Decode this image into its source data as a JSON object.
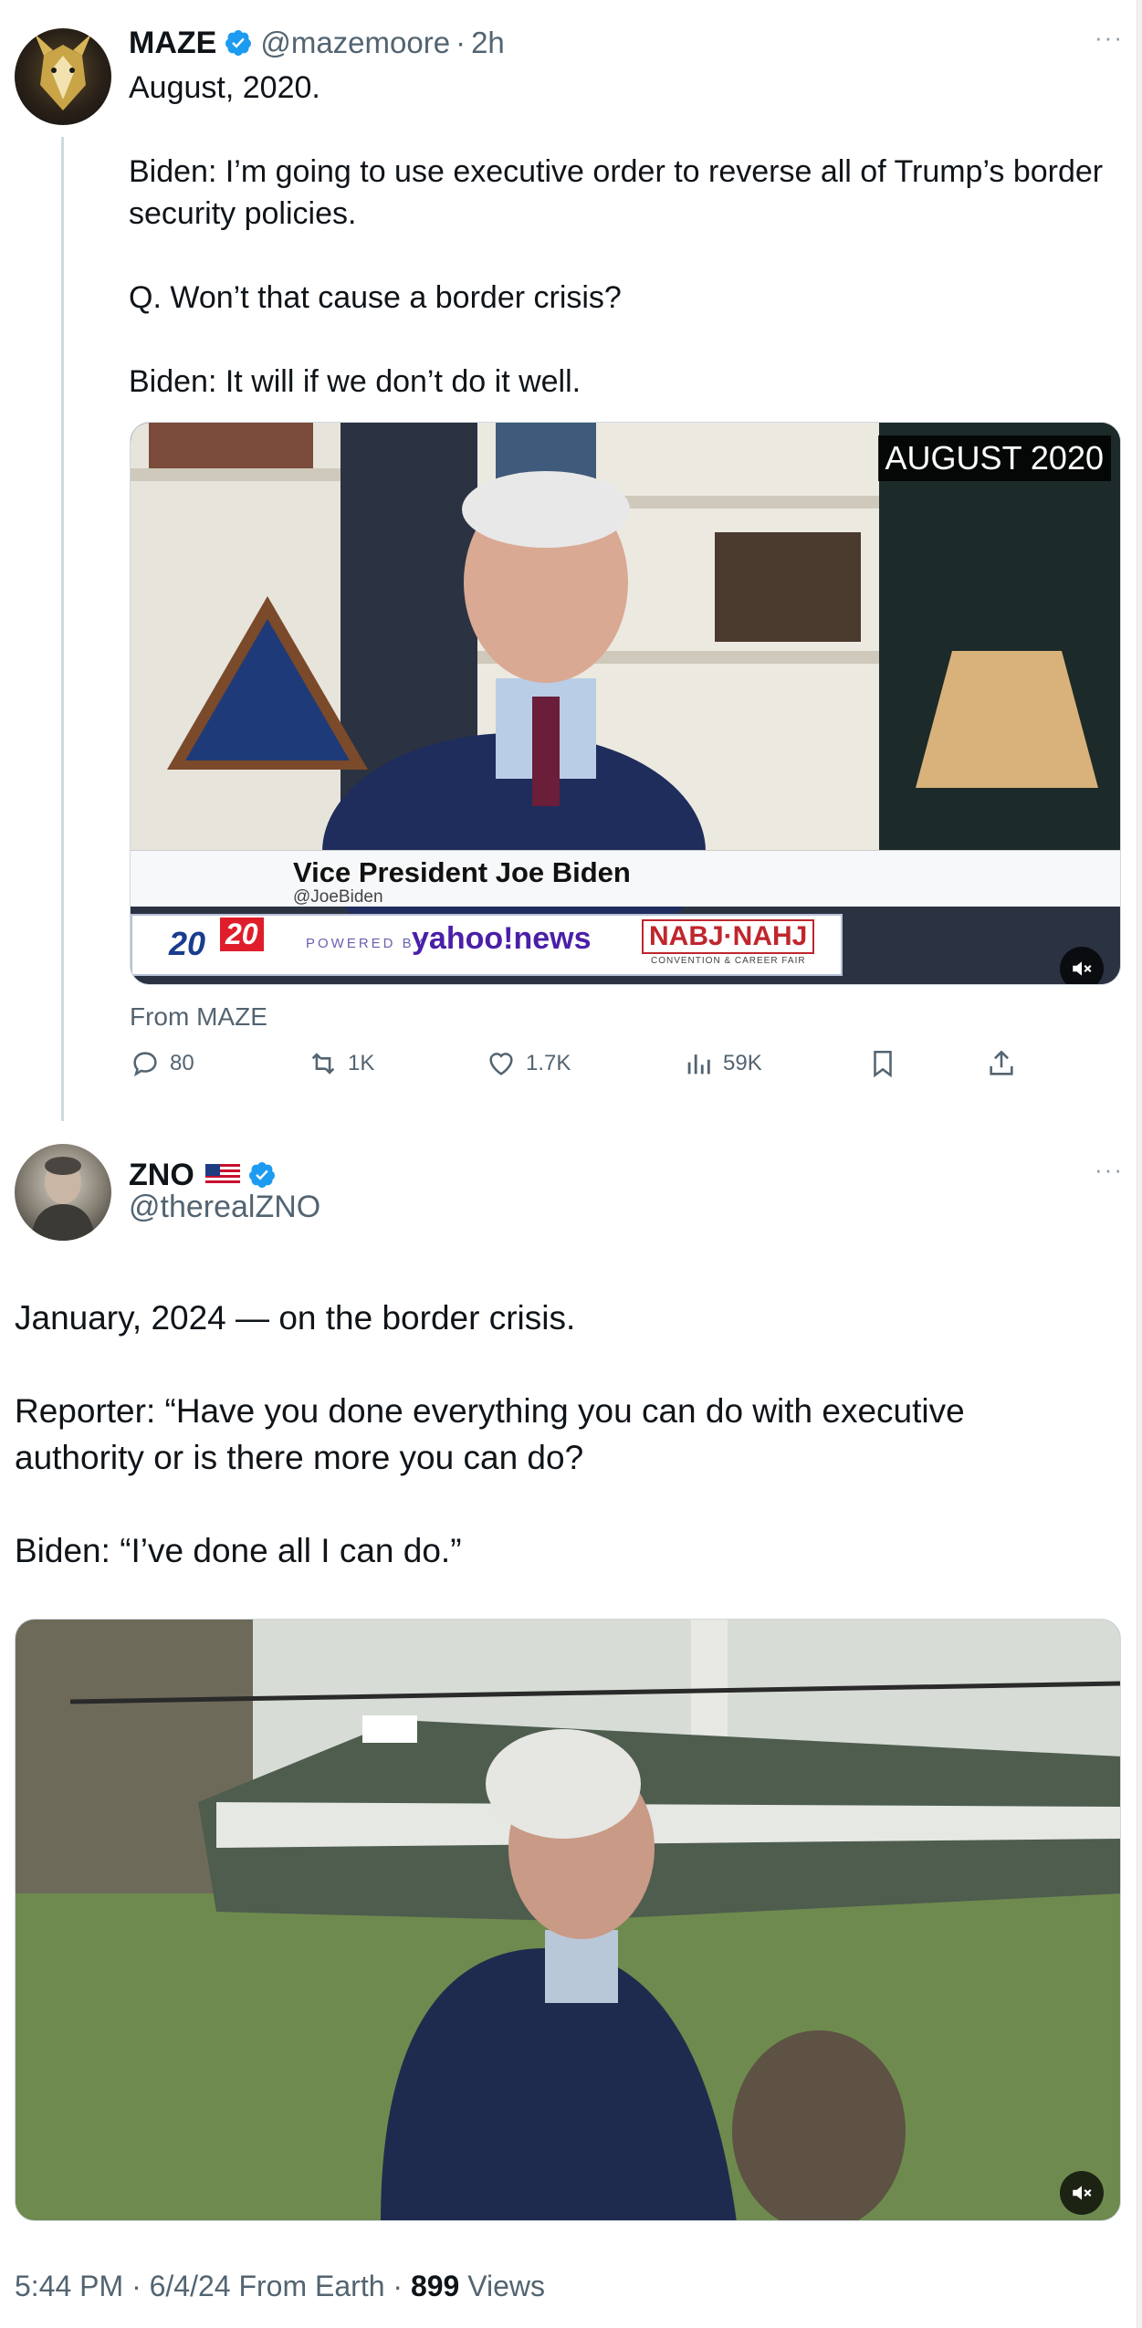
{
  "tweet1": {
    "author": {
      "name": "MAZE",
      "handle": "@mazemoore",
      "time": "2h",
      "separator": "·"
    },
    "more_label": "···",
    "paragraphs": [
      "August, 2020.",
      "Biden: I’m going to use executive order to reverse all of Trump’s border security policies.",
      "Q. Won’t that cause a border crisis?",
      "Biden: It will if we don’t do it well."
    ],
    "video": {
      "corner_caption": "AUGUST 2020",
      "lower_third_name": "Vice President Joe Biden",
      "lower_third_handle": "@JoeBiden",
      "ticker_left": "20",
      "ticker_right": "20",
      "powered_by": "POWERED BY",
      "yahoo": "yahoo!news",
      "nabj": "NABJ·NAHJ",
      "nabj_sub": "CONVENTION & CAREER FAIR"
    },
    "from_label": "From MAZE",
    "actions": {
      "replies": "80",
      "reposts": "1K",
      "likes": "1.7K",
      "views": "59K"
    }
  },
  "tweet2": {
    "author": {
      "name": "ZNO",
      "handle": "@therealZNO"
    },
    "more_label": "···",
    "paragraphs": [
      "January, 2024 — on the border crisis.",
      "Reporter: “Have you done everything you can do with executive authority or is there more you can do?",
      "Biden: “I’ve done all I can do.”"
    ],
    "meta": {
      "time": "5:44 PM",
      "date": "6/4/24",
      "source": "From Earth",
      "views_count": "899",
      "views_label": "Views",
      "separator": "·"
    }
  },
  "colors": {
    "verified_blue": "#1d9bf0",
    "secondary_text": "#536471",
    "thread_line": "#cfd9de"
  }
}
